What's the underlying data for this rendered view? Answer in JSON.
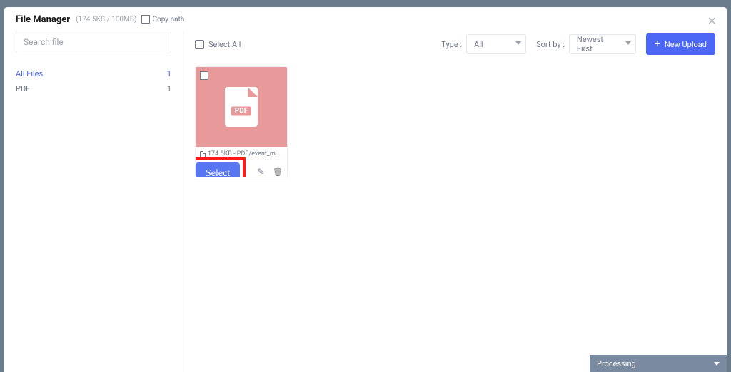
{
  "header": {
    "title": "File Manager",
    "usage": "(174.5KB / 100MB)",
    "copy_path": "Copy path"
  },
  "sidebar": {
    "search_placeholder": "Search file",
    "filters": [
      {
        "label": "All Files",
        "count": "1",
        "active": true
      },
      {
        "label": "PDF",
        "count": "1",
        "active": false
      }
    ]
  },
  "toolbar": {
    "select_all": "Select All",
    "type_label": "Type :",
    "type_value": "All",
    "sort_label": "Sort by :",
    "sort_value": "Newest First",
    "new_upload": "New Upload"
  },
  "file": {
    "badge": "PDF",
    "meta": "174.5KB - PDF/event_m...",
    "select_label": "Select"
  },
  "footer": {
    "processing": "Processing"
  }
}
